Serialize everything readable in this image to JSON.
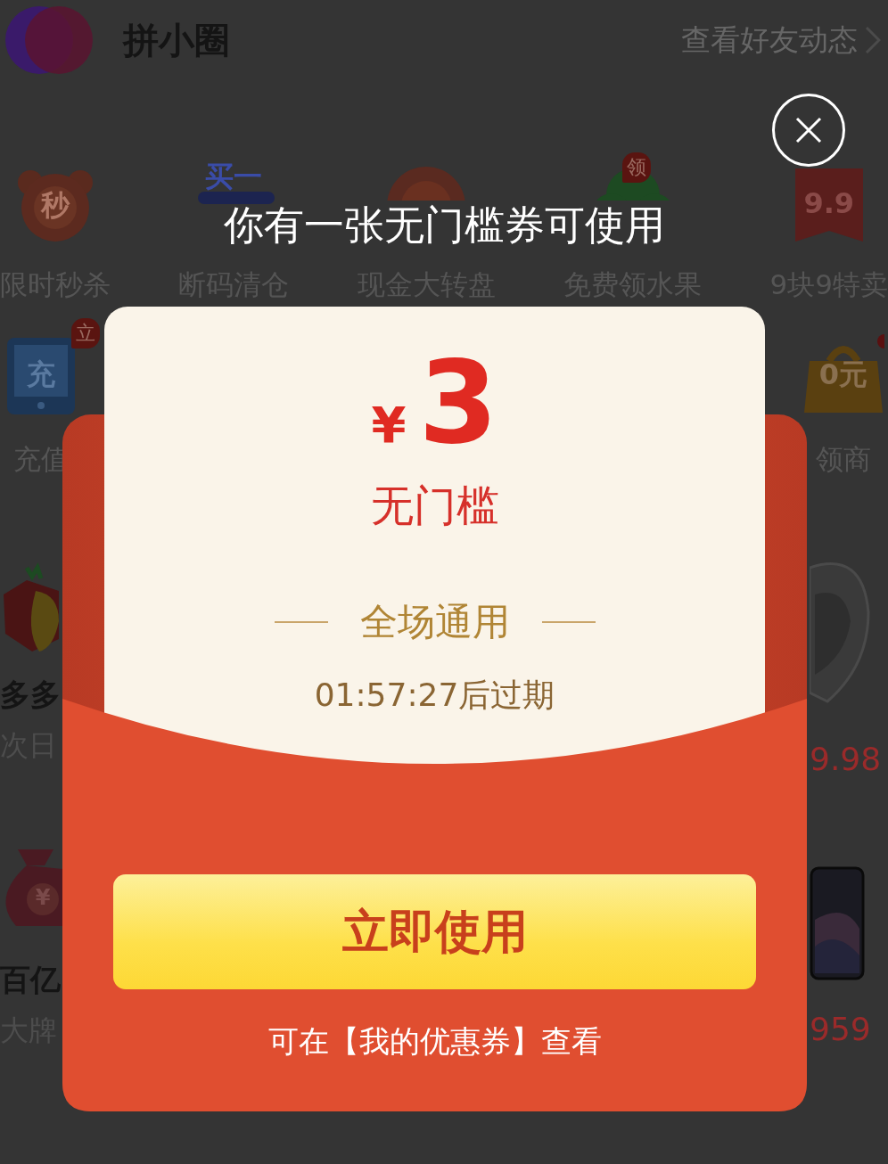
{
  "header": {
    "title": "拼小圈",
    "link": "查看好友动态"
  },
  "shortcuts": [
    {
      "label": "限时秒杀",
      "kind": "clock",
      "icon_text": "秒"
    },
    {
      "label": "断码清仓",
      "kind": "stack",
      "icon_text": "买一"
    },
    {
      "label": "现金大转盘",
      "kind": "wheel"
    },
    {
      "label": "免费领水果",
      "kind": "tree",
      "badge": "领"
    },
    {
      "label": "9块9特卖",
      "kind": "tag",
      "icon_text": "9.9"
    }
  ],
  "shortcuts_row2": [
    {
      "label": "充值",
      "kind": "tablet",
      "icon_text": "充",
      "badge": "立"
    },
    {
      "label": "领商",
      "kind": "bag",
      "icon_text": "0元"
    }
  ],
  "products_left": [
    {
      "title": "多多",
      "subtitle": "次日",
      "kind": "strawberry"
    },
    {
      "title": "百亿",
      "subtitle": "大牌",
      "kind": "money-bag",
      "icon_text": "¥"
    }
  ],
  "products_right": [
    {
      "price": "9.98",
      "kind": "earphone"
    },
    {
      "price": "959",
      "kind": "phone"
    }
  ],
  "popup": {
    "title": "你有一张无门槛券可使用",
    "currency": "¥",
    "amount": "3",
    "condition": "无门槛",
    "scope": "全场通用",
    "expiry": "01:57:27后过期",
    "button": "立即使用",
    "footer": "可在【我的优惠券】查看"
  }
}
